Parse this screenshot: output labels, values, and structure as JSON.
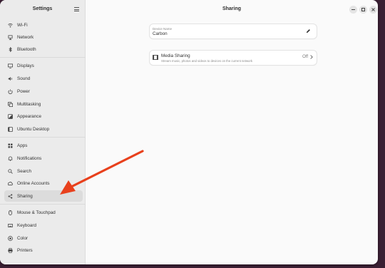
{
  "sidebar": {
    "title": "Settings",
    "items": [
      {
        "label": "Wi-Fi",
        "icon": "wifi-icon"
      },
      {
        "label": "Network",
        "icon": "network-icon"
      },
      {
        "label": "Bluetooth",
        "icon": "bluetooth-icon"
      },
      {
        "label": "Displays",
        "icon": "display-icon"
      },
      {
        "label": "Sound",
        "icon": "speaker-icon"
      },
      {
        "label": "Power",
        "icon": "power-icon"
      },
      {
        "label": "Multitasking",
        "icon": "multitasking-icon"
      },
      {
        "label": "Appearance",
        "icon": "appearance-icon"
      },
      {
        "label": "Ubuntu Desktop",
        "icon": "ubuntu-desktop-icon"
      },
      {
        "label": "Apps",
        "icon": "apps-icon"
      },
      {
        "label": "Notifications",
        "icon": "bell-icon"
      },
      {
        "label": "Search",
        "icon": "search-icon"
      },
      {
        "label": "Online Accounts",
        "icon": "online-accounts-icon"
      },
      {
        "label": "Sharing",
        "icon": "share-icon",
        "active": true
      },
      {
        "label": "Mouse & Touchpad",
        "icon": "mouse-icon"
      },
      {
        "label": "Keyboard",
        "icon": "keyboard-icon"
      },
      {
        "label": "Color",
        "icon": "color-icon"
      },
      {
        "label": "Printers",
        "icon": "printer-icon"
      }
    ]
  },
  "header": {
    "title": "Sharing"
  },
  "device_name": {
    "label": "Device Name",
    "value": "Carbon",
    "edit_icon": "pencil-icon"
  },
  "media_sharing": {
    "title": "Media Sharing",
    "subtitle": "Stream music, photos and videos to devices on the current network",
    "status": "Off",
    "icon": "media-icon"
  },
  "colors": {
    "accent_arrow": "#e8401c",
    "sidebar_bg": "#ebebeb",
    "content_bg": "#fafafa",
    "desktop_bg": "#3a1f33"
  }
}
